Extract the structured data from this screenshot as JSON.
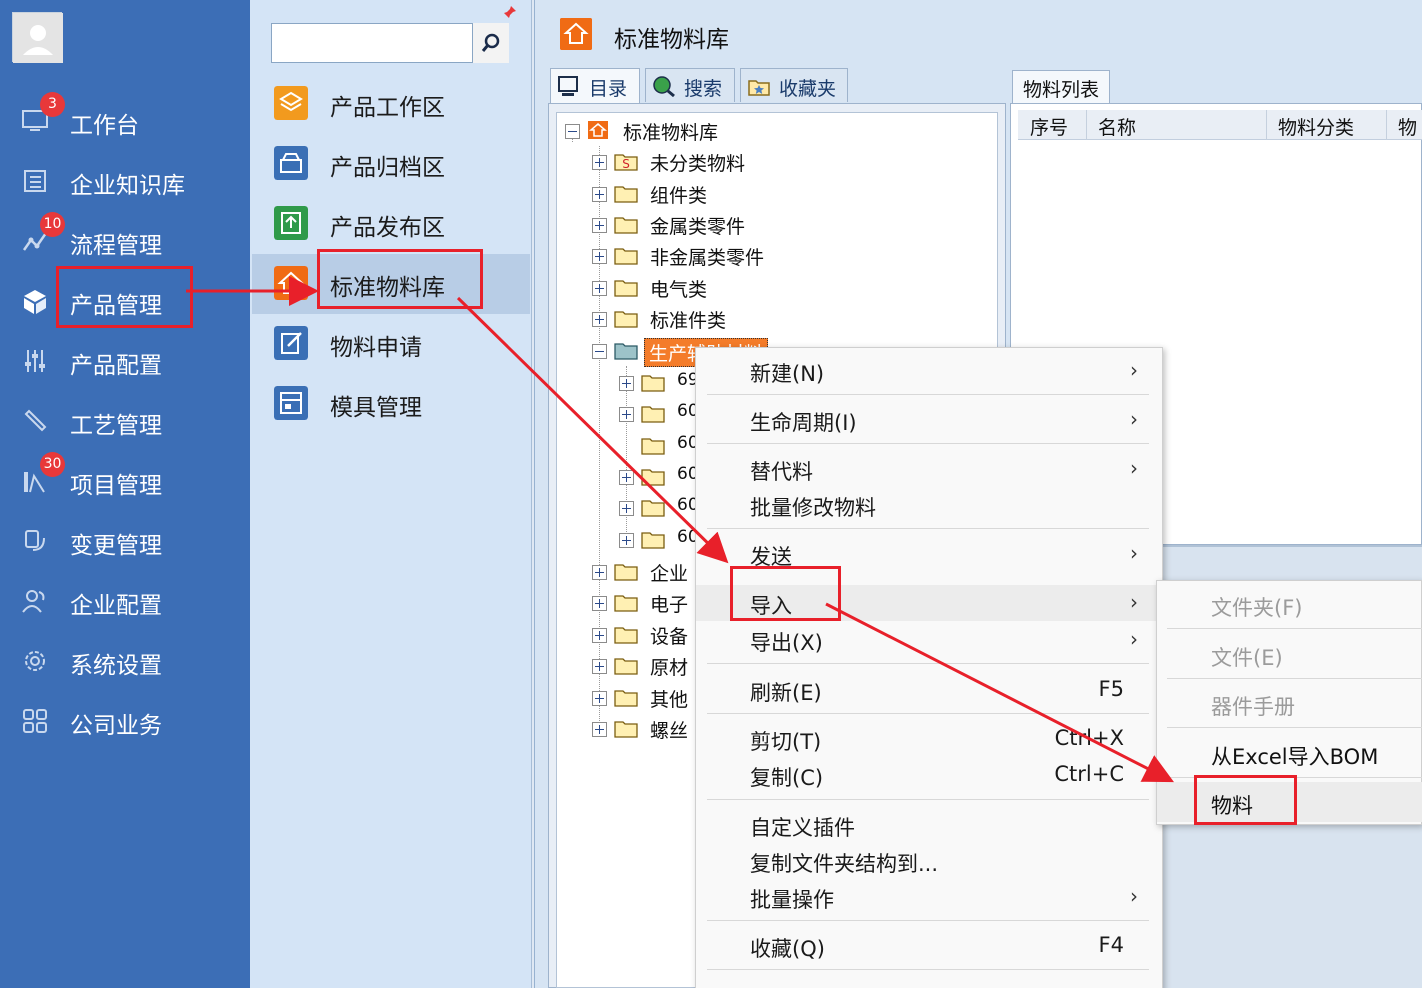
{
  "nav": {
    "items": [
      {
        "label": "工作台",
        "badge": "3",
        "icon": "monitor-icon"
      },
      {
        "label": "企业知识库",
        "badge": "",
        "icon": "book-icon"
      },
      {
        "label": "流程管理",
        "badge": "10",
        "icon": "flow-icon"
      },
      {
        "label": "产品管理",
        "badge": "",
        "icon": "cube-icon"
      },
      {
        "label": "产品配置",
        "badge": "",
        "icon": "sliders-icon"
      },
      {
        "label": "工艺管理",
        "badge": "",
        "icon": "wrench-icon"
      },
      {
        "label": "项目管理",
        "badge": "30",
        "icon": "project-icon"
      },
      {
        "label": "变更管理",
        "badge": "",
        "icon": "change-icon"
      },
      {
        "label": "企业配置",
        "badge": "",
        "icon": "users-icon"
      },
      {
        "label": "系统设置",
        "badge": "",
        "icon": "gear-icon"
      },
      {
        "label": "公司业务",
        "badge": "",
        "icon": "grid-icon"
      }
    ]
  },
  "search": {
    "value": "",
    "placeholder": ""
  },
  "subpanel": {
    "items": [
      {
        "label": "产品工作区",
        "icon": "layers-icon",
        "color": "#f29a1e"
      },
      {
        "label": "产品归档区",
        "icon": "archive-icon",
        "color": "#3a6fb5"
      },
      {
        "label": "产品发布区",
        "icon": "publish-icon",
        "color": "#2f9a4a"
      },
      {
        "label": "标准物料库",
        "icon": "home-icon",
        "color": "#f06b14"
      },
      {
        "label": "物料申请",
        "icon": "edit-icon",
        "color": "#3a6fb5"
      },
      {
        "label": "模具管理",
        "icon": "mold-icon",
        "color": "#3a6fb5"
      }
    ]
  },
  "main": {
    "title": "标准物料库",
    "tabs": [
      "目录",
      "搜索",
      "收藏夹"
    ],
    "list_tab": "物料列表",
    "columns": [
      "序号",
      "名称",
      "物料分类",
      "物"
    ]
  },
  "tree": {
    "root": "标准物料库",
    "nodes": [
      "未分类物料",
      "组件类",
      "金属类零件",
      "非金属类零件",
      "电气类",
      "标准件类",
      "生产辅助材料",
      "69",
      "60",
      "60",
      "60",
      "60",
      "60",
      "企业",
      "电子",
      "设备",
      "原材",
      "其他",
      "螺丝"
    ]
  },
  "context_menu": {
    "items": [
      {
        "label": "新建(N)",
        "shortcut": "",
        "submenu": true
      },
      {
        "label": "生命周期(I)",
        "shortcut": "",
        "submenu": true
      },
      {
        "label": "替代料",
        "shortcut": "",
        "submenu": true
      },
      {
        "label": "批量修改物料",
        "shortcut": "",
        "submenu": false
      },
      {
        "label": "发送",
        "shortcut": "",
        "submenu": true
      },
      {
        "label": "导入",
        "shortcut": "",
        "submenu": true
      },
      {
        "label": "导出(X)",
        "shortcut": "",
        "submenu": true
      },
      {
        "label": "刷新(E)",
        "shortcut": "F5",
        "submenu": false
      },
      {
        "label": "剪切(T)",
        "shortcut": "Ctrl+X",
        "submenu": false
      },
      {
        "label": "复制(C)",
        "shortcut": "Ctrl+C",
        "submenu": false
      },
      {
        "label": "自定义插件",
        "shortcut": "",
        "submenu": false
      },
      {
        "label": "复制文件夹结构到...",
        "shortcut": "",
        "submenu": false
      },
      {
        "label": "批量操作",
        "shortcut": "",
        "submenu": true
      },
      {
        "label": "收藏(Q)",
        "shortcut": "F4",
        "submenu": false
      }
    ],
    "arrow": "›"
  },
  "import_submenu": {
    "items": [
      {
        "label": "文件夹(F)",
        "disabled": true
      },
      {
        "label": "文件(E)",
        "disabled": true
      },
      {
        "label": "器件手册",
        "disabled": true
      },
      {
        "label": "从Excel导入BOM",
        "disabled": false
      },
      {
        "label": "物料",
        "disabled": false
      }
    ]
  },
  "colors": {
    "nav_bg": "#3c6eb6",
    "subpanel_bg": "#d4e4f6",
    "annotation_red": "#e8202a",
    "badge_red": "#e8383a",
    "accent_orange": "#f06b14"
  }
}
